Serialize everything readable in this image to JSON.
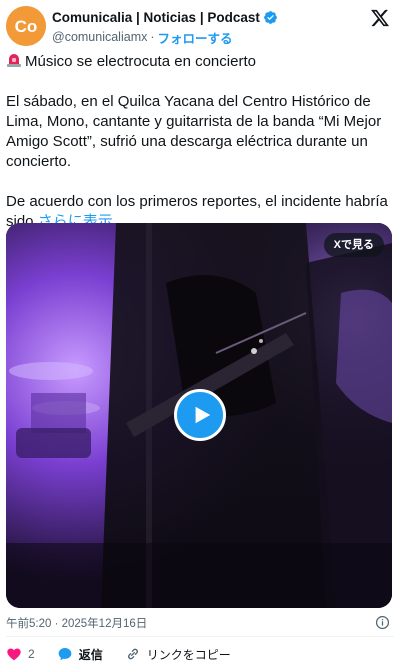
{
  "author": {
    "display_name": "Comunicalia | Noticias | Podcast",
    "handle": "@comunicaliamx",
    "separator": "·",
    "follow_label": "フォローする",
    "avatar_text": "Co",
    "verified": true
  },
  "tweet": {
    "title_line": "Músico se electrocuta en concierto",
    "paragraph_1": "El sábado, en el Quilca Yacana del Centro Histórico de Lima, Mono, cantante y guitarrista de la banda “Mi Mejor Amigo Scott”, sufrió una descarga eléctrica durante un concierto.",
    "paragraph_2": "De acuerdo con los primeros reportes, el incidente habría sido",
    "show_more": "さらに表示"
  },
  "media": {
    "watch_on_x": "Xで見る"
  },
  "timestamp": "午前5:20 · 2025年12月16日",
  "actions": {
    "like_count": "2",
    "reply_label": "返信",
    "copy_link_label": "リンクをコピー"
  },
  "colors": {
    "accent": "#1d9bf0",
    "like_red": "#f91880",
    "avatar_orange": "#f29a38",
    "muted_text": "#536471"
  },
  "icons": [
    "verified-badge-icon",
    "x-logo-icon",
    "siren-icon",
    "play-icon",
    "info-icon",
    "heart-icon",
    "reply-icon",
    "link-icon"
  ]
}
